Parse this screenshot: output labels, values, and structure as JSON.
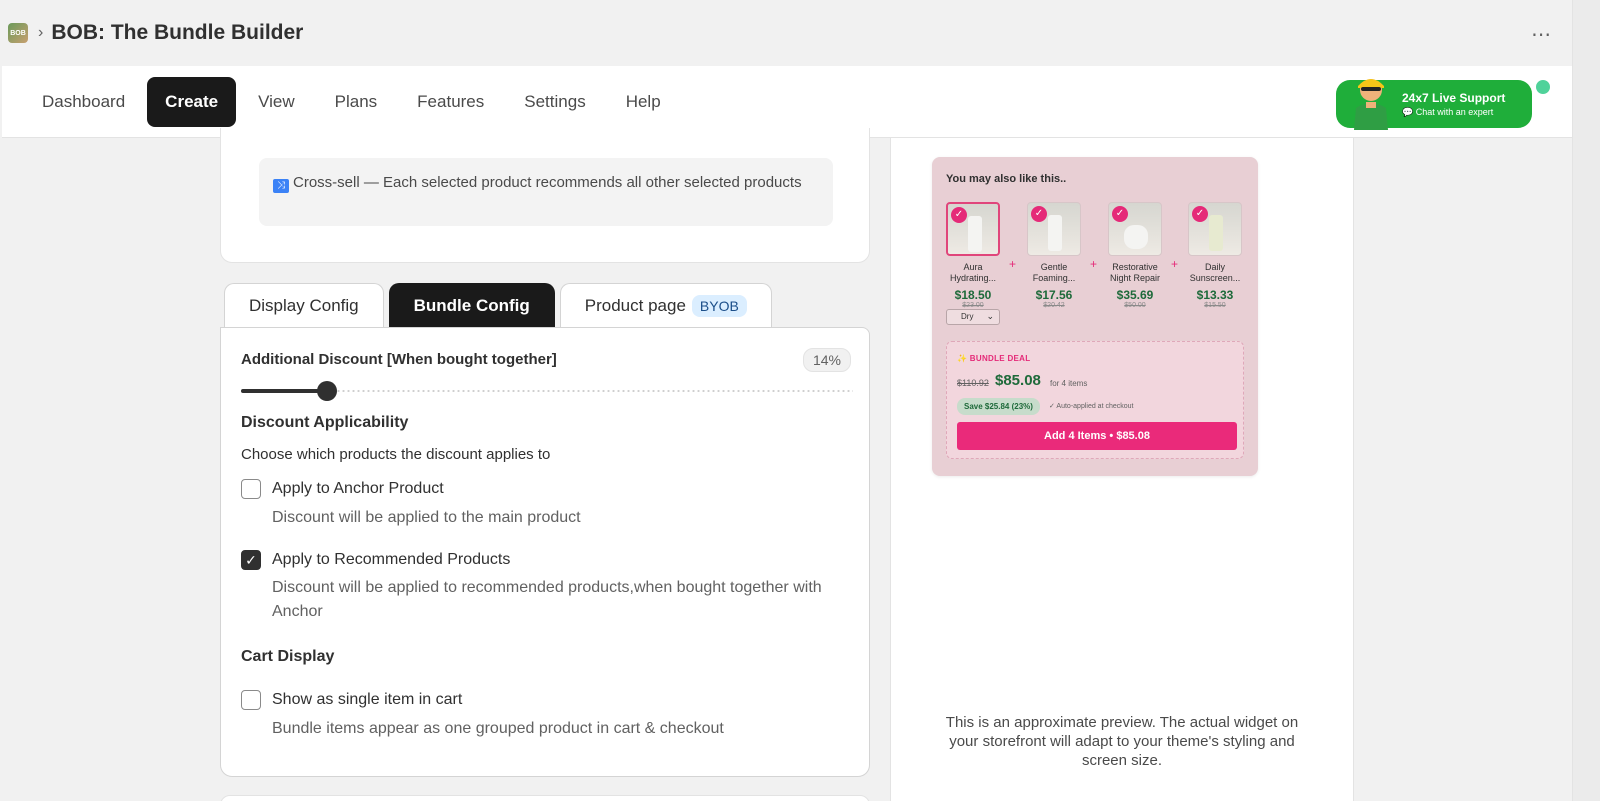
{
  "app": {
    "logo_text": "BOB",
    "title": "BOB: The Bundle Builder",
    "more_label": "⋯"
  },
  "nav": {
    "items": [
      {
        "label": "Dashboard",
        "active": false
      },
      {
        "label": "Create",
        "active": true
      },
      {
        "label": "View",
        "active": false
      },
      {
        "label": "Plans",
        "active": false
      },
      {
        "label": "Features",
        "active": false
      },
      {
        "label": "Settings",
        "active": false
      },
      {
        "label": "Help",
        "active": false
      }
    ]
  },
  "support": {
    "title": "24x7 Live Support",
    "subtitle": "Chat with an expert"
  },
  "crosssell": {
    "text": "Cross-sell — Each selected product recommends all other selected products"
  },
  "tabs": {
    "display_config": "Display Config",
    "bundle_config": "Bundle Config",
    "product_page": "Product page",
    "byob_badge": "BYOB"
  },
  "config": {
    "discount_label": "Additional Discount [When bought together]",
    "discount_value": "14%",
    "discount_fraction": 0.14,
    "applicability_heading": "Discount Applicability",
    "applicability_desc": "Choose which products the discount applies to",
    "anchor_label": "Apply to Anchor Product",
    "anchor_desc": "Discount will be applied to the main product",
    "anchor_checked": false,
    "recommended_label": "Apply to Recommended Products",
    "recommended_desc": "Discount will be applied to recommended products,when bought together with Anchor",
    "recommended_checked": true,
    "cart_heading": "Cart Display",
    "single_item_label": "Show as single item in cart",
    "single_item_desc": "Bundle items appear as one grouped product in cart & checkout",
    "single_item_checked": false
  },
  "preview": {
    "widget_title": "You may also like this..",
    "products": [
      {
        "name_line1": "Aura",
        "name_line2": "Hydrating...",
        "price": "$18.50",
        "old_price": "$23.00"
      },
      {
        "name_line1": "Gentle",
        "name_line2": "Foaming...",
        "price": "$17.56",
        "old_price": "$20.42"
      },
      {
        "name_line1": "Restorative",
        "name_line2": "Night Repair",
        "price": "$35.69",
        "old_price": "$50.00"
      },
      {
        "name_line1": "Daily",
        "name_line2": "Sunscreen...",
        "price": "$13.33",
        "old_price": "$15.50"
      }
    ],
    "variant": "Dry",
    "deal": {
      "tag": "✨ BUNDLE DEAL",
      "old_total": "$110.92",
      "new_total": "$85.08",
      "for_items": "for 4 items",
      "save": "Save $25.84 (23%)",
      "auto_applied": "✓ Auto-applied at checkout",
      "button": "Add 4 Items • $85.08"
    },
    "note": "This is an approximate preview. The actual widget on your storefront will adapt to your theme's styling and screen size."
  },
  "colors": {
    "accent_dark": "#1a1a1a",
    "support_green": "#1fae3a",
    "deal_pink": "#ea2a7a",
    "price_green": "#1e6a3a"
  }
}
